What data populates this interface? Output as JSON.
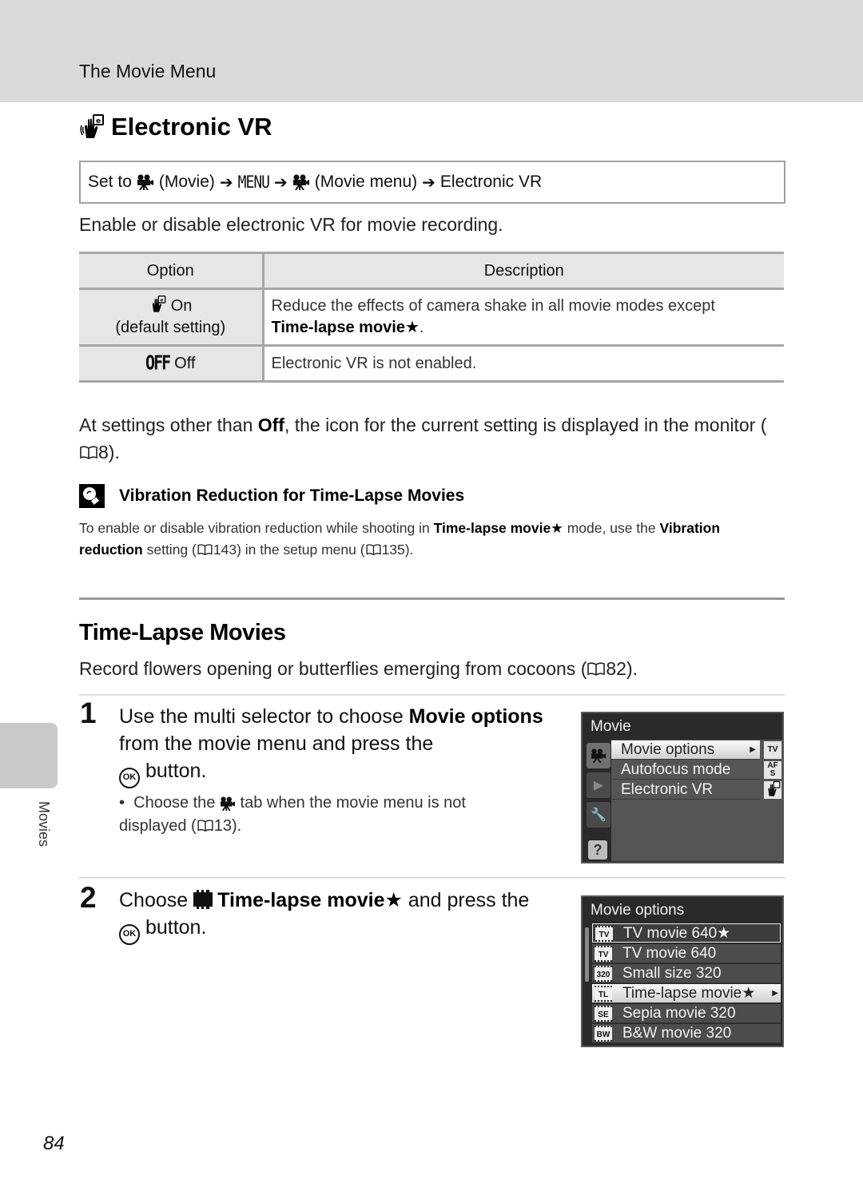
{
  "header": {
    "section": "The Movie Menu"
  },
  "electronic_vr": {
    "icon": "electronic-vr-icon",
    "title": "Electronic VR",
    "path": {
      "set_to": "Set to",
      "movie_label": "(Movie)",
      "menu_label": "MENU",
      "movie_menu_label": "(Movie menu)",
      "final": "Electronic VR",
      "arrow": "➔"
    },
    "intro": "Enable or disable electronic VR for movie recording.",
    "table": {
      "headers": [
        "Option",
        "Description"
      ],
      "rows": [
        {
          "icon": "electronic-vr-icon",
          "option": "On",
          "option_note": "(default setting)",
          "description": "Reduce the effects of camera shake in all movie modes except",
          "description_bold": "Time-lapse movie★",
          "description_end": "."
        },
        {
          "icon_text": "OFF",
          "option": "Off",
          "description": "Electronic VR is not enabled."
        }
      ]
    },
    "note": {
      "pre": "At settings other than ",
      "bold": "Off",
      "post": ", the icon for the current setting is displayed in the monitor (",
      "ref": "8",
      "end": ")."
    },
    "tip": {
      "icon": "tip-lightbulb-icon",
      "title": "Vibration Reduction for Time-Lapse Movies",
      "text_1": "To enable or disable vibration reduction while shooting in ",
      "bold_1": "Time-lapse movie★",
      "text_2": " mode, use the ",
      "bold_2": "Vibration reduction",
      "text_3": " setting (",
      "ref_1": "143",
      "text_4": ") in the setup menu (",
      "ref_2": "135",
      "text_5": ")."
    }
  },
  "time_lapse": {
    "title": "Time-Lapse Movies",
    "intro_pre": "Record flowers opening or butterflies emerging from cocoons (",
    "intro_ref": "82",
    "intro_end": ").",
    "steps": [
      {
        "number": "1",
        "text_1": "Use the multi selector to choose ",
        "bold": "Movie options",
        "text_2": " from the movie menu and press the ",
        "ok": "OK",
        "text_3": " button.",
        "bullet_pre": "Choose the ",
        "bullet_post": " tab when the movie menu is not displayed (",
        "bullet_ref": "13",
        "bullet_end": ")."
      },
      {
        "number": "2",
        "text_1": "Choose ",
        "bold": "Time-lapse movie★",
        "text_2": " and press the ",
        "ok": "OK",
        "text_3": " button."
      }
    ]
  },
  "screen_movie_menu": {
    "title": "Movie",
    "tabs": [
      "movie-tab",
      "playback-tab",
      "setup-tab",
      "help-tab"
    ],
    "items": [
      {
        "label": "Movie options",
        "icon_text": "TV",
        "selected": true
      },
      {
        "label": "Autofocus mode",
        "icon_text": "AF S",
        "selected": false
      },
      {
        "label": "Electronic VR",
        "icon_text": "VR",
        "selected": false
      }
    ],
    "help_glyph": "?"
  },
  "screen_movie_options": {
    "title": "Movie options",
    "items": [
      {
        "label": "TV movie 640★",
        "icon_text": "TV",
        "state": "current"
      },
      {
        "label": "TV movie 640",
        "icon_text": "TV",
        "state": ""
      },
      {
        "label": "Small size 320",
        "icon_text": "320",
        "state": ""
      },
      {
        "label": "Time-lapse movie★",
        "icon_text": "TL",
        "state": "selected"
      },
      {
        "label": "Sepia movie 320",
        "icon_text": "SE",
        "state": ""
      },
      {
        "label": "B&W movie 320",
        "icon_text": "BW",
        "state": ""
      }
    ]
  },
  "side_tab": {
    "label": "Movies"
  },
  "page_number": "84"
}
